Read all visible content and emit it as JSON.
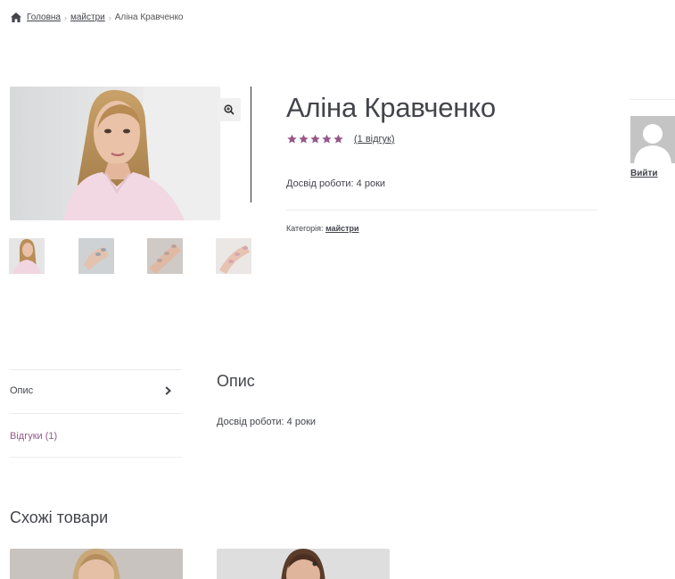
{
  "breadcrumb": {
    "home": "Головна",
    "category": "майстри",
    "current": "Аліна Кравченко",
    "icon": "home-icon"
  },
  "product": {
    "title": "Аліна Кравченко",
    "rating_value": 5,
    "rating_max": 5,
    "review_link": "(1 відгук)",
    "experience": "Досвід роботи: 4 роки",
    "category_label": "Категорія:",
    "category_link": "майстри",
    "star_color": "#96588a"
  },
  "gallery": {
    "zoom_icon": "magnifier-zoom-icon",
    "thumbs": [
      "portrait",
      "nails-1",
      "nails-2",
      "nails-3"
    ]
  },
  "sidebar": {
    "avatar_icon": "user-avatar-icon",
    "logout": "Вийти"
  },
  "tabs": {
    "description": "Опис",
    "reviews": "Відгуки (1)",
    "active_color": "#96588a"
  },
  "description": {
    "heading": "Опис",
    "text": "Досвід роботи: 4 роки"
  },
  "related": {
    "heading": "Схожі товари"
  }
}
